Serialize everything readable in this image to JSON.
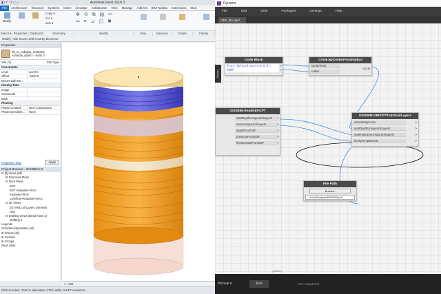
{
  "revit": {
    "title": "Autodesk Revit 2018.3",
    "tabs": [
      "File",
      "Architecture",
      "Structure",
      "Systems",
      "Insert",
      "Annotate",
      "Collaborate",
      "View",
      "Manage",
      "Add-Ins",
      "BIM Toolbar",
      "Extensions",
      "Mod"
    ],
    "ribbon": {
      "modify": "Modify",
      "select": "Select ▾",
      "properties": "Properties",
      "clipboard": "Clipboard",
      "geometry": "Geometry",
      "modify_panel": "Modify",
      "view": "View",
      "measure": "Measure",
      "create": "Create",
      "family_editor": "Family",
      "cope": "Cope ▾",
      "cut": "Cut ▾",
      "join": "Join ▾"
    },
    "options_bar": "Modify | Site     Moves With Nearby Elements",
    "properties": {
      "header": "Properties",
      "type_name": "00_Si_collapse_SoilSand\nexample_depth = -5440.0",
      "site_label": "Site (1)",
      "edit_type": "Edit Type",
      "groups": [
        {
          "name": "Constraints",
          "rows": [
            [
              "Level",
              "Level 0"
            ],
            [
              "Offset",
              "-5440.0"
            ],
            [
              "Moves With Ne...",
              ""
            ]
          ]
        },
        {
          "name": "Identity Data",
          "rows": [
            [
              "Image",
              ""
            ],
            [
              "Comments",
              ""
            ],
            [
              "Mark",
              ""
            ]
          ]
        },
        {
          "name": "Phasing",
          "rows": [
            [
              "Phase Created",
              "New Construction"
            ],
            [
              "Phase Demolish...",
              "None"
            ]
          ]
        }
      ],
      "help": "Properties help",
      "apply": "Apply"
    },
    "browser": {
      "header": "Project Browser - GIS2BIM.rvt",
      "items": [
        {
          "t": "⊟ [0] Views (all)",
          "d": 0
        },
        {
          "t": "⊞ Structural Plans",
          "d": 1
        },
        {
          "t": "⊟ Floor Plans",
          "d": 1
        },
        {
          "t": "BGT",
          "d": 2
        },
        {
          "t": "BGT+Kadaster+BAG",
          "d": 2
        },
        {
          "t": "Kadaster+BAG",
          "d": 2
        },
        {
          "t": "Luchtfoto+Kadaster+BAG",
          "d": 2
        },
        {
          "t": "⊟ 3D Views",
          "d": 1
        },
        {
          "t": "3D AHN3 all Layers Unresolv",
          "d": 2
        },
        {
          "t": "{3D}",
          "d": 2
        },
        {
          "t": "⊟ Drafting Views (Detail View 1)",
          "d": 1
        },
        {
          "t": "Drafting 1",
          "d": 2
        },
        {
          "t": "Legends",
          "d": 0
        },
        {
          "t": "Schedules/Quantities (all)",
          "d": 0
        },
        {
          "t": "⊞ Sheets (all)",
          "d": 0
        },
        {
          "t": "⊞ Families",
          "d": 0
        },
        {
          "t": "⊞ Groups",
          "d": 0
        },
        {
          "t": "Revit Links",
          "d": 0
        }
      ]
    },
    "view_bar": "1 : 100",
    "status": "Click to select, TAB for alternates, CTRL adds, SHIFT unselects."
  },
  "dynamo": {
    "title": "Dynamo",
    "menu": [
      "File",
      "Edit",
      "View",
      "Packages",
      "Settings",
      "Help"
    ],
    "tab": "GEF_file.dyn*",
    "library": "Library",
    "run_mode": "Manual",
    "run_button": "Run",
    "status": "Run completed.",
    "nodes": {
      "code_block": {
        "title": "Code Block",
        "code": [
          "Point.ByCoordinates(0,0,0);",
          "5000;"
        ],
        "out1": ">",
        "out2": ">"
      },
      "circle": {
        "title": "Circle.ByCenterPointRadius",
        "in": [
          "centerPoint",
          "radius"
        ],
        "out": "Circle"
      },
      "read_gef": {
        "title": "GIS2BIM.ReadGEFCPT",
        "outs": [
          "startDepthUniqueSoilLayers",
          "nameUniqueSoilLayers",
          "depthFromGEF",
          "pressureFromGEF",
          "frictionRatioFromGEF"
        ]
      },
      "soil_layers": {
        "title": "GIS2BIM.GEFCPTTo3DSoilLayers",
        "ins": [
          "closedPolyCurve",
          "startDepthUniqueSoilLayers",
          "materialnameUniqueSoilLayers",
          "familyTemplateSite"
        ],
        "outs": [
          ">",
          ">",
          ">",
          ">"
        ]
      },
      "file_path": {
        "title": "File Path",
        "browse": "Browse...",
        "path": "...\\\\Voidt\\Dropbox\\PAM\\N\\Site.rft"
      }
    },
    "canvas_footer": "(Hidden)"
  }
}
